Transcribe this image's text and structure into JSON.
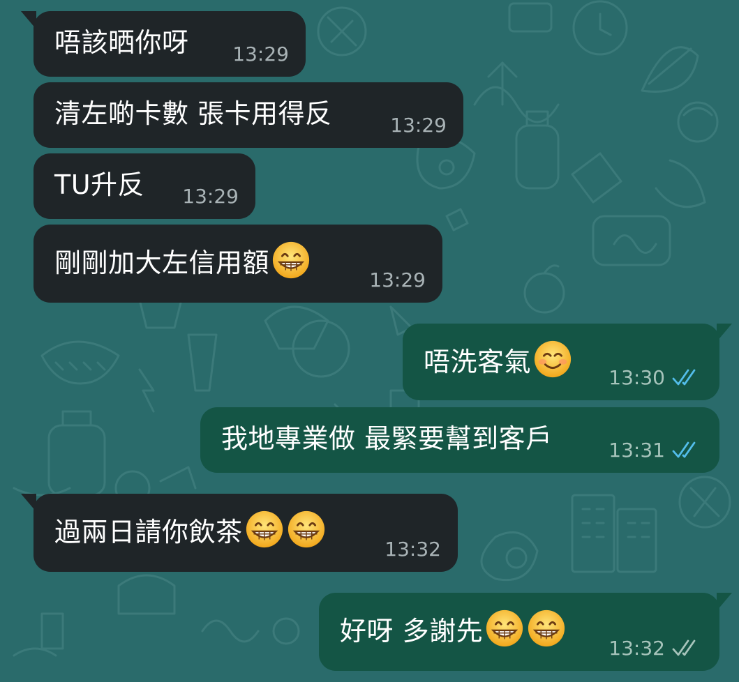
{
  "colors": {
    "wallpaper": "#2a6b6b",
    "incoming_bubble": "#1f2528",
    "outgoing_bubble": "#145545",
    "read_tick": "#53bdeb",
    "delivered_tick": "#a7c4bb"
  },
  "messages": [
    {
      "direction": "in",
      "text": "唔該晒你呀",
      "emoji_count": 0,
      "emoji": "",
      "time": "13:29"
    },
    {
      "direction": "in",
      "text": "清左啲卡數 張卡用得反",
      "emoji_count": 0,
      "emoji": "",
      "time": "13:29"
    },
    {
      "direction": "in",
      "text": "TU升反",
      "emoji_count": 0,
      "emoji": "",
      "time": "13:29"
    },
    {
      "direction": "in",
      "text": "剛剛加大左信用額",
      "emoji_count": 1,
      "emoji": "grinning-face-emoji",
      "time": "13:29"
    },
    {
      "direction": "out",
      "text": "唔洗客氣",
      "emoji_count": 1,
      "emoji": "smiling-face-emoji",
      "time": "13:30",
      "status": "read",
      "status_icon": "double-check-icon"
    },
    {
      "direction": "out",
      "text": "我地專業做 最緊要幫到客戶",
      "emoji_count": 0,
      "emoji": "",
      "time": "13:31",
      "status": "read",
      "status_icon": "double-check-icon"
    },
    {
      "direction": "in",
      "text": "過兩日請你飲茶",
      "emoji_count": 2,
      "emoji": "grinning-face-emoji",
      "time": "13:32"
    },
    {
      "direction": "out",
      "text": "好呀 多謝先",
      "emoji_count": 2,
      "emoji": "grinning-face-emoji",
      "time": "13:32",
      "status": "delivered",
      "status_icon": "double-check-icon"
    }
  ]
}
